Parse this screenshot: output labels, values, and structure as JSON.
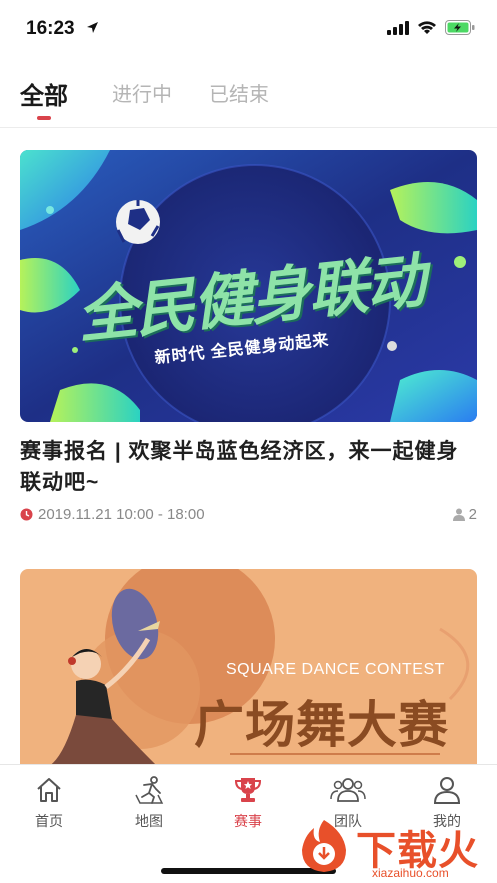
{
  "status_bar": {
    "time": "16:23"
  },
  "tabs": [
    {
      "label": "全部",
      "active": true
    },
    {
      "label": "进行中",
      "active": false
    },
    {
      "label": "已结束",
      "active": false
    }
  ],
  "cards": [
    {
      "banner_heading": "全民健身联动",
      "banner_subheading": "新时代 全民健身动起来",
      "title": "赛事报名 | 欢聚半岛蓝色经济区，来一起健身联动吧~",
      "time": "2019.11.21 10:00 - 18:00",
      "participants": "2"
    },
    {
      "banner_subtitle": "SQUARE DANCE CONTEST",
      "banner_heading": "广场舞大赛"
    }
  ],
  "bottom_nav": [
    {
      "label": "首页",
      "icon": "home-icon"
    },
    {
      "label": "地图",
      "icon": "map-icon"
    },
    {
      "label": "赛事",
      "icon": "trophy-icon",
      "active": true
    },
    {
      "label": "团队",
      "icon": "team-icon"
    },
    {
      "label": "我的",
      "icon": "user-icon"
    }
  ],
  "watermark": {
    "text": "下载火",
    "url": "xiazaihuo.com"
  },
  "colors": {
    "accent": "#d9434b",
    "inactive_tab": "#b5b5b5",
    "watermark": "#e8502a"
  }
}
